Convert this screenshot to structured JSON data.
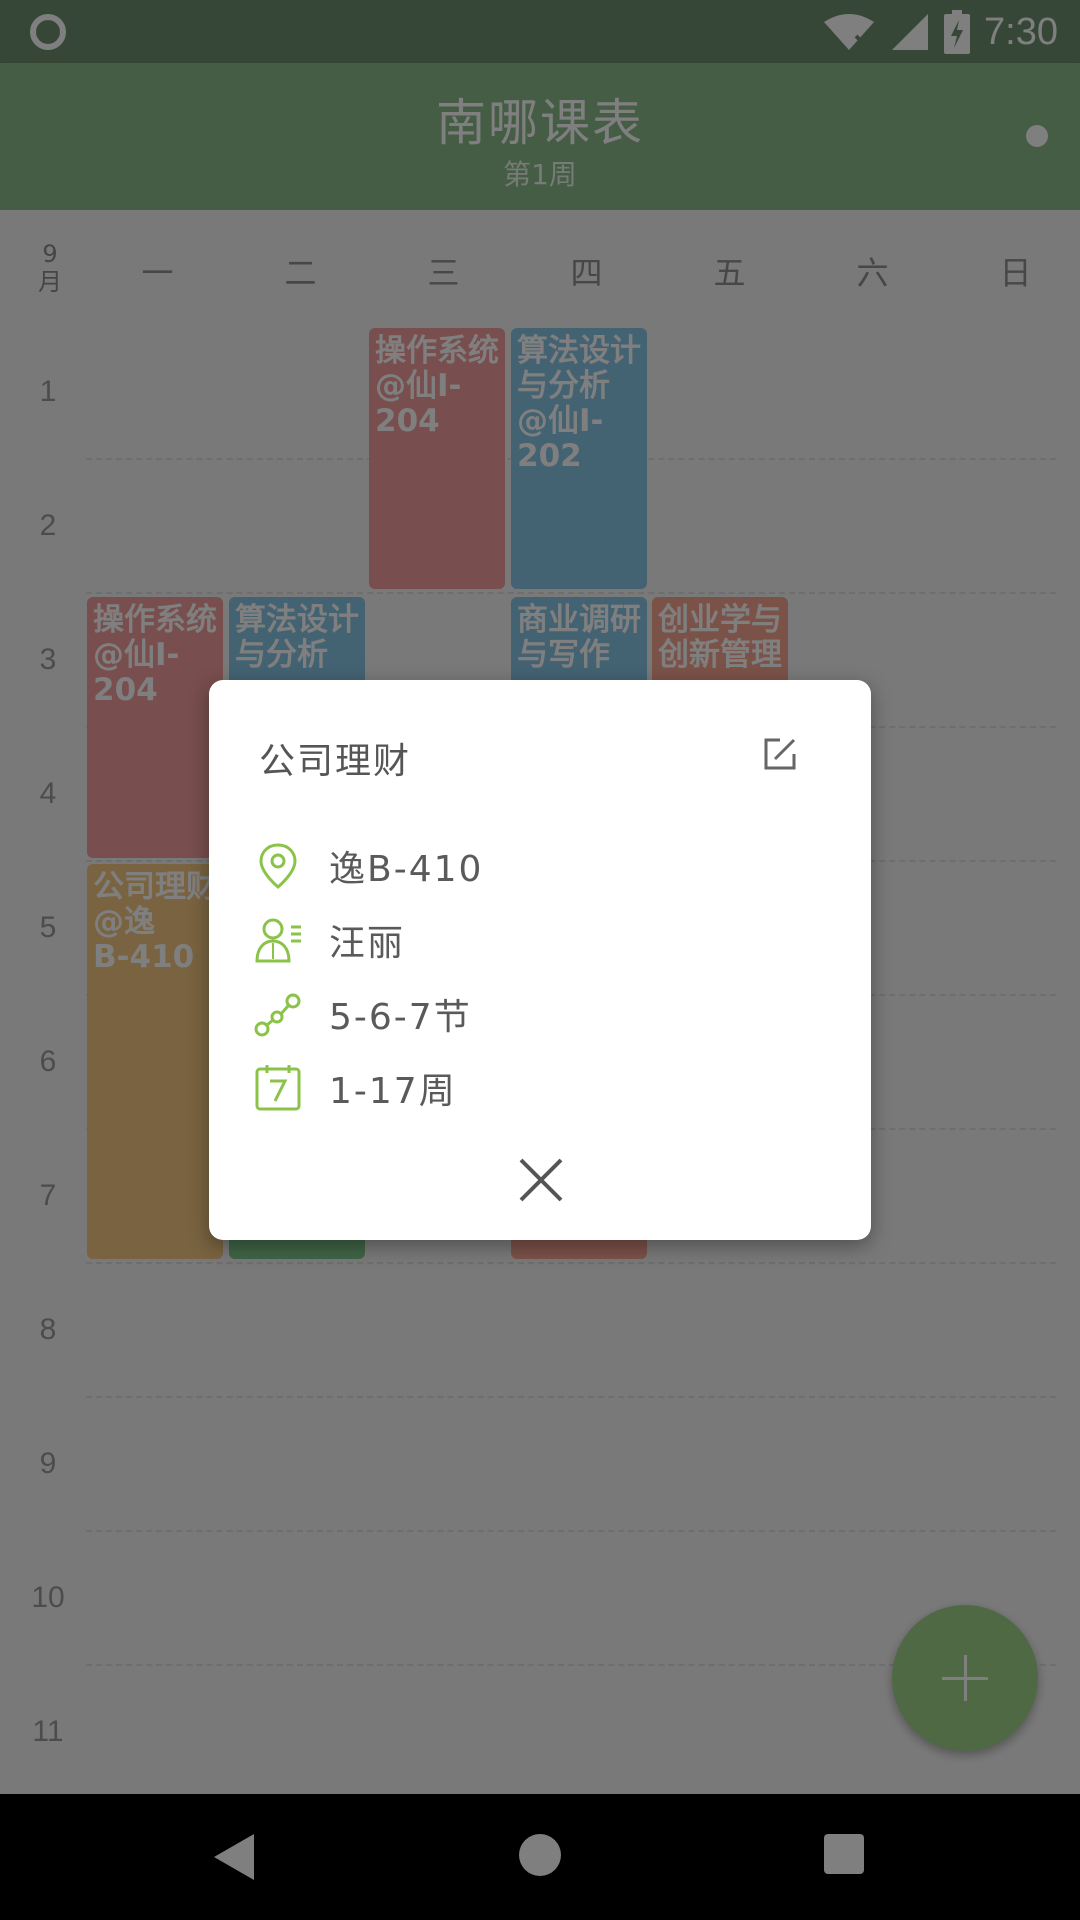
{
  "status_bar": {
    "time": "7:30",
    "icons": [
      "circle-notification-icon",
      "wifi-icon",
      "signal-icon",
      "battery-charging-icon"
    ]
  },
  "app_bar": {
    "title": "南哪课表",
    "subtitle": "第1周"
  },
  "schedule": {
    "month_line1": "9",
    "month_line2": "月",
    "days": [
      "一",
      "二",
      "三",
      "四",
      "五",
      "六",
      "日"
    ],
    "periods": [
      "1",
      "2",
      "3",
      "4",
      "5",
      "6",
      "7",
      "8",
      "9",
      "10",
      "11"
    ],
    "courses": [
      {
        "text": "操作系统\n@仙I-204",
        "color": "pink"
      },
      {
        "text": "算法设计\n与分析\n@仙I-202",
        "color": "blue"
      },
      {
        "text": "操作系统\n@仙I-204",
        "color": "pink"
      },
      {
        "text": "算法设计\n与分析",
        "color": "blue"
      },
      {
        "text": "商业调研\n与写作",
        "color": "blue"
      },
      {
        "text": "创业学与\n创新管理",
        "color": "salmon"
      },
      {
        "text": "公司理财\n@逸\nB-410",
        "color": "sand"
      },
      {
        "text": "",
        "color": "green"
      },
      {
        "text": "",
        "color": "salmon"
      }
    ]
  },
  "fab": {
    "icon": "plus-icon"
  },
  "dialog": {
    "title": "公司理财",
    "location": "逸B-410",
    "teacher": "汪丽",
    "sections": "5-6-7节",
    "weeks": "1-17周",
    "icons": {
      "edit": "edit-icon",
      "location": "location-pin-icon",
      "teacher": "teacher-icon",
      "sections": "sections-icon",
      "weeks": "calendar-icon",
      "close": "close-icon"
    },
    "accent_color": "#8bc34a"
  },
  "colors": {
    "primary": "#8ab98a",
    "status_bar": "#6f8f6e",
    "course_pink": "#f19c9c",
    "course_blue": "#86c4e4",
    "course_sand": "#f2c680",
    "course_green": "#7ec98d",
    "course_salmon": "#f6a590",
    "fab": "#9ed38a"
  }
}
